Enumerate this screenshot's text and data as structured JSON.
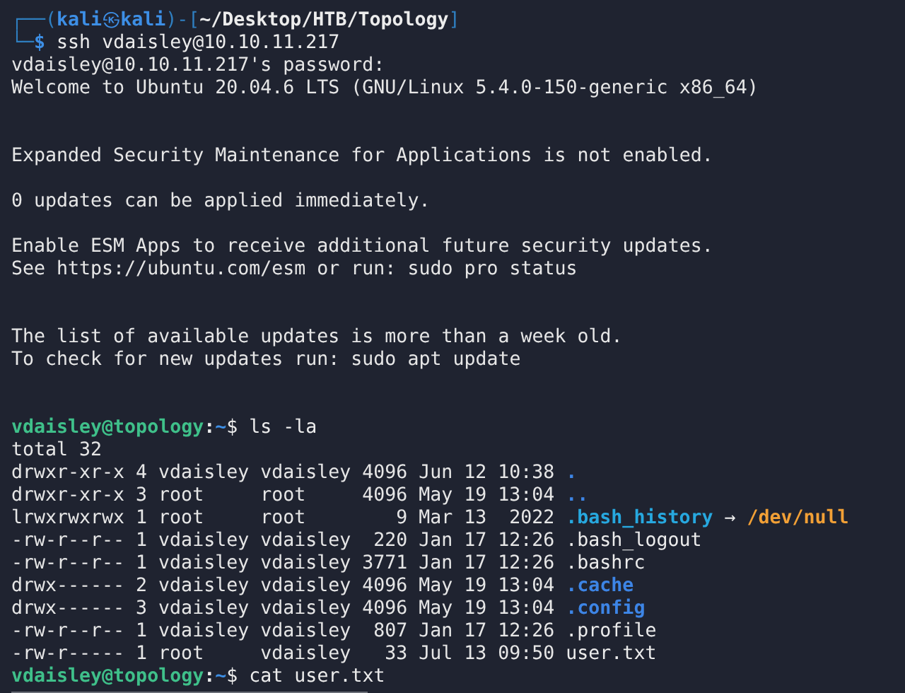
{
  "kali_prompt": {
    "frame_top": "┌──(",
    "user": "kali",
    "at": "㉿",
    "host": "kali",
    "mid": ")-[",
    "path": "~/Desktop/HTB/Topology",
    "close": "]",
    "frame_bottom": "└─",
    "symbol": "$",
    "command": "ssh vdaisley@10.10.11.217"
  },
  "output_blocks": [
    [
      "vdaisley@10.10.11.217's password:",
      "Welcome to Ubuntu 20.04.6 LTS (GNU/Linux 5.4.0-150-generic x86_64)"
    ],
    [
      "Expanded Security Maintenance for Applications is not enabled."
    ],
    [
      "0 updates can be applied immediately."
    ],
    [
      "Enable ESM Apps to receive additional future security updates.",
      "See https://ubuntu.com/esm or run: sudo pro status"
    ],
    [
      "The list of available updates is more than a week old.",
      "To check for new updates run: sudo apt update"
    ]
  ],
  "ls_prompt": {
    "user_host": "vdaisley@topology",
    "colon": ":",
    "path": "~",
    "symbol": "$",
    "command": "ls -la"
  },
  "total": "total 32",
  "listing": [
    {
      "perms": "drwxr-xr-x",
      "links": "4",
      "owner": "vdaisley",
      "group": "vdaisley",
      "size": "4096",
      "month": "Jun",
      "day": "12",
      "time": "10:38",
      "name": ".",
      "kind": "dir"
    },
    {
      "perms": "drwxr-xr-x",
      "links": "3",
      "owner": "root",
      "group": "root",
      "size": "4096",
      "month": "May",
      "day": "19",
      "time": "13:04",
      "name": "..",
      "kind": "dir"
    },
    {
      "perms": "lrwxrwxrwx",
      "links": "1",
      "owner": "root",
      "group": "root",
      "size": "9",
      "month": "Mar",
      "day": "13",
      "time": "2022",
      "name": ".bash_history",
      "kind": "symlink",
      "arrow": "→",
      "target": "/dev/null"
    },
    {
      "perms": "-rw-r--r--",
      "links": "1",
      "owner": "vdaisley",
      "group": "vdaisley",
      "size": "220",
      "month": "Jan",
      "day": "17",
      "time": "12:26",
      "name": ".bash_logout",
      "kind": "file"
    },
    {
      "perms": "-rw-r--r--",
      "links": "1",
      "owner": "vdaisley",
      "group": "vdaisley",
      "size": "3771",
      "month": "Jan",
      "day": "17",
      "time": "12:26",
      "name": ".bashrc",
      "kind": "file"
    },
    {
      "perms": "drwx------",
      "links": "2",
      "owner": "vdaisley",
      "group": "vdaisley",
      "size": "4096",
      "month": "May",
      "day": "19",
      "time": "13:04",
      "name": ".cache",
      "kind": "dir"
    },
    {
      "perms": "drwx------",
      "links": "3",
      "owner": "vdaisley",
      "group": "vdaisley",
      "size": "4096",
      "month": "May",
      "day": "19",
      "time": "13:04",
      "name": ".config",
      "kind": "dir"
    },
    {
      "perms": "-rw-r--r--",
      "links": "1",
      "owner": "vdaisley",
      "group": "vdaisley",
      "size": "807",
      "month": "Jan",
      "day": "17",
      "time": "12:26",
      "name": ".profile",
      "kind": "file"
    },
    {
      "perms": "-rw-r-----",
      "links": "1",
      "owner": "root",
      "group": "vdaisley",
      "size": "33",
      "month": "Jul",
      "day": "13",
      "time": "09:50",
      "name": "user.txt",
      "kind": "file"
    }
  ],
  "cat_prompt": {
    "user_host": "vdaisley@topology",
    "colon": ":",
    "path": "~",
    "symbol": "$",
    "command": "cat user.txt"
  },
  "cat_output": {
    "redacted": true
  }
}
